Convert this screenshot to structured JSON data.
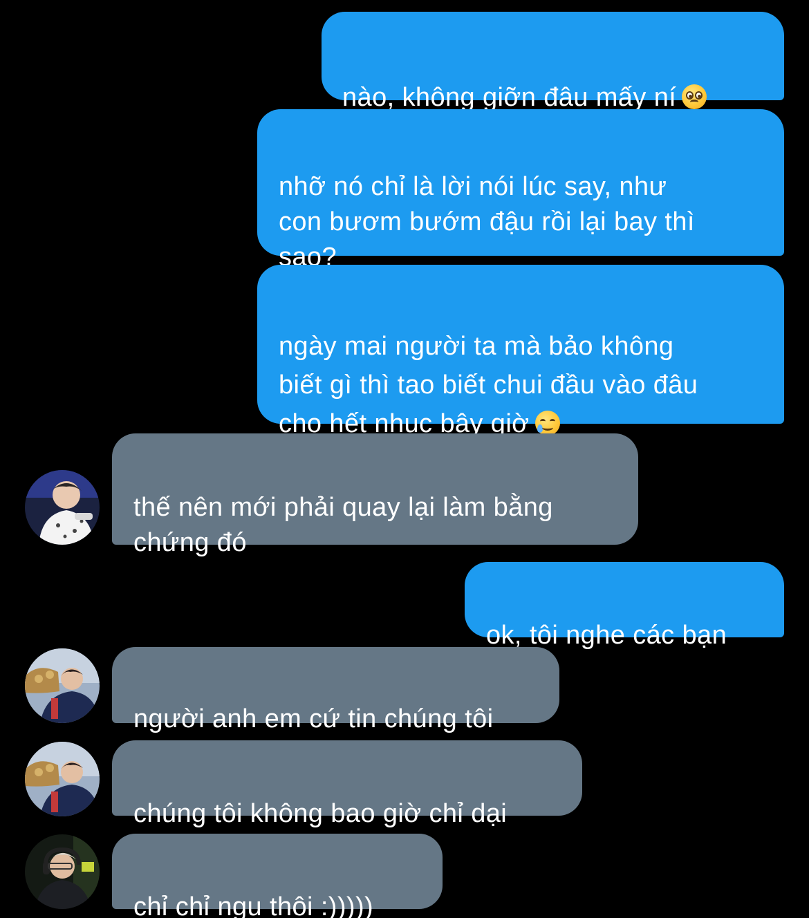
{
  "messages": [
    {
      "direction": "outgoing",
      "text": "nào, không giỡn đâu mấy ní",
      "emoji": "pleading-face-emoji"
    },
    {
      "direction": "outgoing",
      "text": "nhỡ nó chỉ là lời nói lúc say, như\ncon bươm bướm đậu rồi lại bay thì\nsao?"
    },
    {
      "direction": "outgoing",
      "text": "ngày mai người ta mà bảo không\nbiết gì thì tao biết chui đầu vào đâu\ncho hết nhục bây giờ",
      "emoji": "smiling-face-with-tear-emoji"
    },
    {
      "direction": "incoming",
      "text": "thế nên mới phải quay lại làm bằng\nchứng đó",
      "avatar": "avatar-icon"
    },
    {
      "direction": "outgoing",
      "text": "ok, tôi nghe các bạn"
    },
    {
      "direction": "incoming",
      "text": "người anh em cứ tin chúng tôi",
      "avatar": "avatar-icon"
    },
    {
      "direction": "incoming",
      "text": "chúng tôi không bao giờ chỉ dại",
      "avatar": "avatar-icon"
    },
    {
      "direction": "incoming",
      "text": "chỉ chỉ ngu thôi :)))))",
      "avatar": "avatar-icon"
    }
  ],
  "colors": {
    "background": "#000000",
    "outgoing_bubble": "#1d9bf0",
    "incoming_bubble": "#657786",
    "text": "#ffffff"
  }
}
